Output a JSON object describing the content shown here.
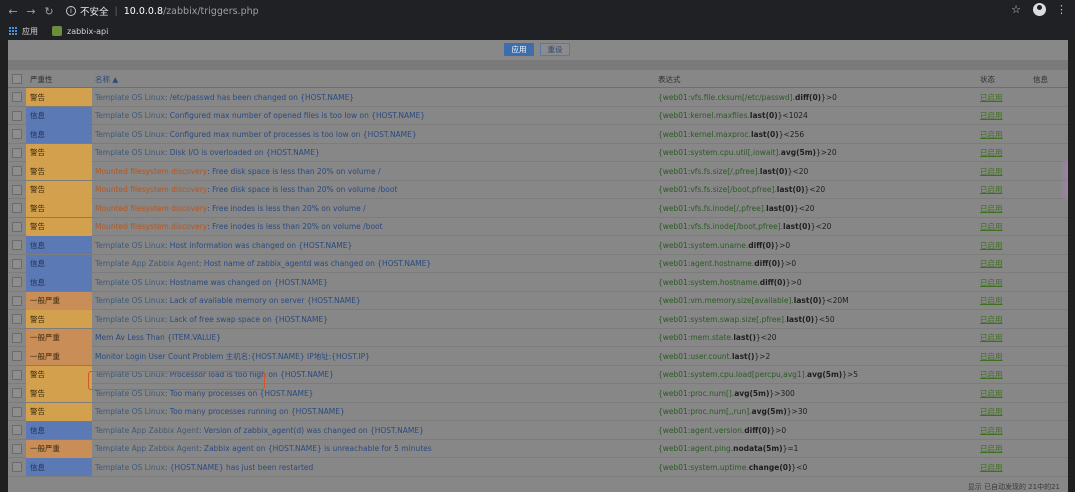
{
  "browser": {
    "insecure_label": "不安全",
    "separator": "|",
    "url_host": "10.0.0.8",
    "url_path": "/zabbix/triggers.php",
    "bookmarks": [
      {
        "label": "应用",
        "icon": "apps-grid-icon"
      },
      {
        "label": "zabbix-api",
        "icon": "zabbix-favicon-icon"
      }
    ]
  },
  "filter": {
    "apply_label": "应用",
    "reset_label": "重设"
  },
  "table": {
    "headers": {
      "severity": "严重性",
      "name": "名称 ▲",
      "expression": "表达式",
      "status": "状态",
      "info": "信息"
    },
    "rows": [
      {
        "severity": "警告",
        "sev_class": "warning",
        "prefix": "Template OS Linux",
        "prefix_type": "template",
        "name": ": /etc/passwd has been changed on {HOST.NAME}",
        "expr_pre": "{web01:vfs.file.cksum[/etc/passwd].",
        "expr_fn": "diff(0)",
        "expr_post": "}>0",
        "status": "已启用"
      },
      {
        "severity": "信息",
        "sev_class": "info",
        "prefix": "Template OS Linux",
        "prefix_type": "template",
        "name": ": Configured max number of opened files is too low on {HOST.NAME}",
        "expr_pre": "{web01:kernel.maxfiles.",
        "expr_fn": "last(0)",
        "expr_post": "}<1024",
        "status": "已启用"
      },
      {
        "severity": "信息",
        "sev_class": "info",
        "prefix": "Template OS Linux",
        "prefix_type": "template",
        "name": ": Configured max number of processes is too low on {HOST.NAME}",
        "expr_pre": "{web01:kernel.maxproc.",
        "expr_fn": "last(0)",
        "expr_post": "}<256",
        "status": "已启用"
      },
      {
        "severity": "警告",
        "sev_class": "warning",
        "prefix": "Template OS Linux",
        "prefix_type": "template",
        "name": ": Disk I/O is overloaded on {HOST.NAME}",
        "expr_pre": "{web01:system.cpu.util[,iowait].",
        "expr_fn": "avg(5m)",
        "expr_post": "}>20",
        "status": "已启用"
      },
      {
        "severity": "警告",
        "sev_class": "warning",
        "prefix": "Mounted filesystem discovery",
        "prefix_type": "discovery",
        "name": ": Free disk space is less than 20% on volume /",
        "expr_pre": "{web01:vfs.fs.size[/,pfree].",
        "expr_fn": "last(0)",
        "expr_post": "}<20",
        "status": "已启用"
      },
      {
        "severity": "警告",
        "sev_class": "warning",
        "prefix": "Mounted filesystem discovery",
        "prefix_type": "discovery",
        "name": ": Free disk space is less than 20% on volume /boot",
        "expr_pre": "{web01:vfs.fs.size[/boot,pfree].",
        "expr_fn": "last(0)",
        "expr_post": "}<20",
        "status": "已启用"
      },
      {
        "severity": "警告",
        "sev_class": "warning",
        "prefix": "Mounted filesystem discovery",
        "prefix_type": "discovery",
        "name": ": Free inodes is less than 20% on volume /",
        "expr_pre": "{web01:vfs.fs.inode[/,pfree].",
        "expr_fn": "last(0)",
        "expr_post": "}<20",
        "status": "已启用"
      },
      {
        "severity": "警告",
        "sev_class": "warning",
        "prefix": "Mounted filesystem discovery",
        "prefix_type": "discovery",
        "name": ": Free inodes is less than 20% on volume /boot",
        "expr_pre": "{web01:vfs.fs.inode[/boot,pfree].",
        "expr_fn": "last(0)",
        "expr_post": "}<20",
        "status": "已启用"
      },
      {
        "severity": "信息",
        "sev_class": "info",
        "prefix": "Template OS Linux",
        "prefix_type": "template",
        "name": ": Host information was changed on {HOST.NAME}",
        "expr_pre": "{web01:system.uname.",
        "expr_fn": "diff(0)",
        "expr_post": "}>0",
        "status": "已启用"
      },
      {
        "severity": "信息",
        "sev_class": "info",
        "prefix": "Template App Zabbix Agent",
        "prefix_type": "template",
        "name": ": Host name of zabbix_agentd was changed on {HOST.NAME}",
        "expr_pre": "{web01:agent.hostname.",
        "expr_fn": "diff(0)",
        "expr_post": "}>0",
        "status": "已启用"
      },
      {
        "severity": "信息",
        "sev_class": "info",
        "prefix": "Template OS Linux",
        "prefix_type": "template",
        "name": ": Hostname was changed on {HOST.NAME}",
        "expr_pre": "{web01:system.hostname.",
        "expr_fn": "diff(0)",
        "expr_post": "}>0",
        "status": "已启用"
      },
      {
        "severity": "一般严重",
        "sev_class": "average",
        "prefix": "Template OS Linux",
        "prefix_type": "template",
        "name": ": Lack of available memory on server {HOST.NAME}",
        "expr_pre": "{web01:vm.memory.size[available].",
        "expr_fn": "last(0)",
        "expr_post": "}<20M",
        "status": "已启用"
      },
      {
        "severity": "警告",
        "sev_class": "warning",
        "prefix": "Template OS Linux",
        "prefix_type": "template",
        "name": ": Lack of free swap space on {HOST.NAME}",
        "expr_pre": "{web01:system.swap.size[,pfree].",
        "expr_fn": "last(0)",
        "expr_post": "}<50",
        "status": "已启用"
      },
      {
        "severity": "一般严重",
        "sev_class": "average",
        "prefix": "",
        "prefix_type": "none",
        "name": "Mem Av Less Than {ITEM.VALUE}",
        "expr_pre": "{web01:mem.state.",
        "expr_fn": "last()",
        "expr_post": "}<20",
        "status": "已启用"
      },
      {
        "severity": "一般严重",
        "sev_class": "average",
        "prefix": "",
        "prefix_type": "none",
        "name": "Monitor Login User Count Problem 主机名:{HOST.NAME} IP地址:{HOST.IP}",
        "expr_pre": "{web01:user.count.",
        "expr_fn": "last()",
        "expr_post": "}>2",
        "status": "已启用"
      },
      {
        "severity": "警告",
        "sev_class": "warning",
        "prefix": "Template OS Linux",
        "prefix_type": "template",
        "name": ": Processor load is too high on {HOST.NAME}",
        "expr_pre": "{web01:system.cpu.load[percpu,avg1].",
        "expr_fn": "avg(5m)",
        "expr_post": "}>5",
        "status": "已启用"
      },
      {
        "severity": "警告",
        "sev_class": "warning",
        "prefix": "Template OS Linux",
        "prefix_type": "template",
        "name": ": Too many processes on {HOST.NAME}",
        "expr_pre": "{web01:proc.num[].",
        "expr_fn": "avg(5m)",
        "expr_post": "}>300",
        "status": "已启用"
      },
      {
        "severity": "警告",
        "sev_class": "warning",
        "prefix": "Template OS Linux",
        "prefix_type": "template",
        "name": ": Too many processes running on {HOST.NAME}",
        "expr_pre": "{web01:proc.num[,,run].",
        "expr_fn": "avg(5m)",
        "expr_post": "}>30",
        "status": "已启用"
      },
      {
        "severity": "信息",
        "sev_class": "info",
        "prefix": "Template App Zabbix Agent",
        "prefix_type": "template",
        "name": ": Version of zabbix_agent(d) was changed on {HOST.NAME}",
        "expr_pre": "{web01:agent.version.",
        "expr_fn": "diff(0)",
        "expr_post": "}>0",
        "status": "已启用"
      },
      {
        "severity": "一般严重",
        "sev_class": "average",
        "prefix": "Template App Zabbix Agent",
        "prefix_type": "template",
        "name": ": Zabbix agent on {HOST.NAME} is unreachable for 5 minutes",
        "expr_pre": "{web01:agent.ping.",
        "expr_fn": "nodata(5m)",
        "expr_post": "}=1",
        "status": "已启用"
      },
      {
        "severity": "信息",
        "sev_class": "info",
        "prefix": "Template OS Linux",
        "prefix_type": "template",
        "name": ": {HOST.NAME} has just been restarted",
        "expr_pre": "{web01:system.uptime.",
        "expr_fn": "change(0)",
        "expr_post": "}<0",
        "status": "已启用"
      }
    ]
  },
  "footer": {
    "text": "显示 已自动发现的 21中的21"
  },
  "colors": {
    "warning": "#d3a04e",
    "info": "#5b79b5",
    "average": "#c98d57",
    "highlight": "#d4562a"
  }
}
